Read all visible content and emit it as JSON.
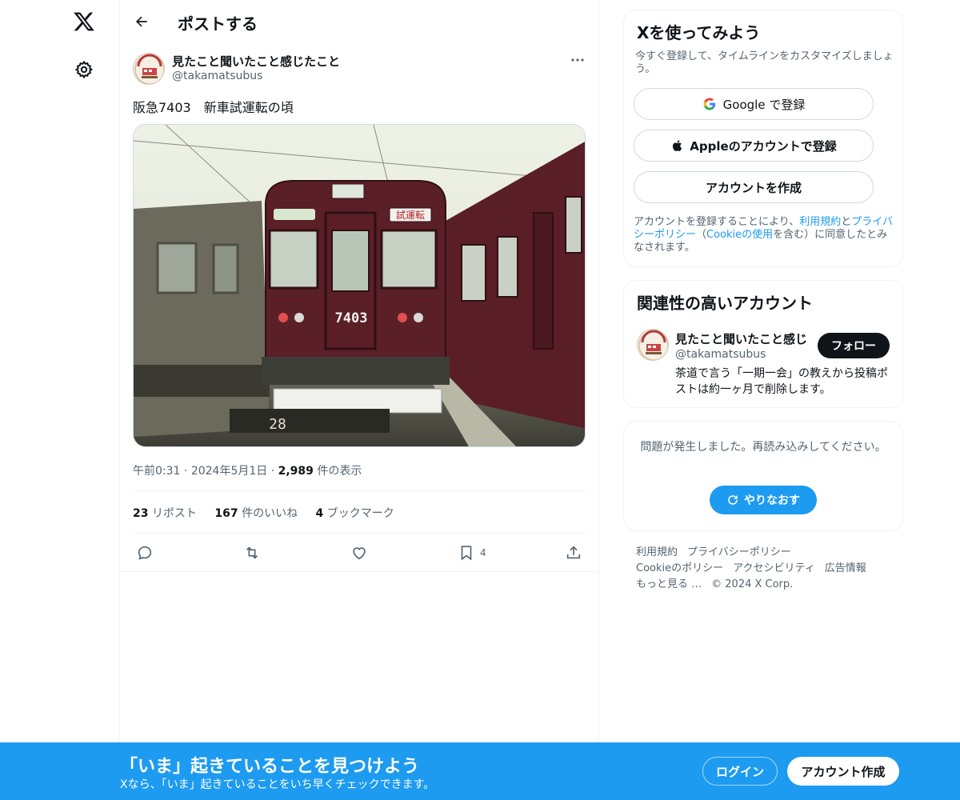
{
  "nav": {
    "logo": "x-logo-icon",
    "settings": "gear-icon"
  },
  "header": {
    "title": "ポストする",
    "back": "arrow-left-icon"
  },
  "post": {
    "author_name": "見たこと聞いたこと感じたこと",
    "author_handle": "@takamatsubus",
    "text": "阪急7403　新車試運転の頃",
    "image_train_number": "7403",
    "image_destination_sign": "試運転",
    "image_track_marker": "28",
    "time": "午前0:31",
    "date": "2024年5月1日",
    "views_count": "2,989",
    "views_label": "件の表示",
    "reposts_count": "23",
    "reposts_label": "リポスト",
    "likes_count": "167",
    "likes_label": "件のいいね",
    "bookmarks_count": "4",
    "bookmarks_label": "ブックマーク",
    "bookmark_action_count": "4"
  },
  "signup_card": {
    "title": "Xを使ってみよう",
    "subtitle": "今すぐ登録して、タイムラインをカスタマイズしましょう。",
    "google_label": "Google で登録",
    "apple_label": "Appleのアカウントで登録",
    "create_label": "アカウントを作成",
    "terms_pre": "アカウントを登録することにより、",
    "terms_link": "利用規約",
    "terms_and": "と",
    "privacy_link": "プライバシーポリシー",
    "cookie_open": "（",
    "cookie_link": "Cookieの使用",
    "terms_post": "を含む）に同意したとみなされます。"
  },
  "related": {
    "title": "関連性の高いアカウント",
    "name": "見たこと聞いたこと感じ",
    "handle": "@takamatsubus",
    "bio": "茶道で言う「一期一会」の教えから投稿ポストは約一ヶ月で削除します。",
    "follow_label": "フォロー"
  },
  "error_card": {
    "message": "問題が発生しました。再読み込みしてください。",
    "retry_label": "やりなおす"
  },
  "footer": {
    "links": [
      "利用規約",
      "プライバシーポリシー",
      "Cookieのポリシー",
      "アクセシビリティ",
      "広告情報",
      "もっと見る …"
    ],
    "copyright": "© 2024 X Corp."
  },
  "bottom_bar": {
    "title": "「いま」起きていることを見つけよう",
    "subtitle": "Xなら、「いま」起きていることをいち早くチェックできます。",
    "login_label": "ログイン",
    "signup_label": "アカウント作成"
  },
  "colors": {
    "accent": "#1d9bf0",
    "text": "#0f1419",
    "muted": "#536471",
    "border": "#eff3f4",
    "train": "#5b1f28"
  }
}
